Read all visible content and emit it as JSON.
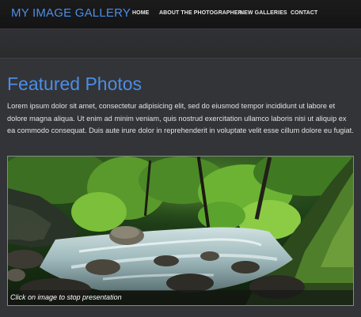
{
  "header": {
    "site_title": "MY IMAGE GALLERY",
    "nav": [
      {
        "label": "HOME"
      },
      {
        "label": "ABOUT THE PHOTOGRAPHER"
      },
      {
        "label": "NEW GALLERIES"
      },
      {
        "label": "CONTACT"
      }
    ]
  },
  "main": {
    "title": "Featured Photos",
    "intro": "Lorem ipsum dolor sit amet, consectetur adipisicing elit, sed do eiusmod tempor incididunt ut labore et dolore magna aliqua. Ut enim ad minim veniam, quis nostrud exercitation ullamco laboris nisi ut aliquip ex ea commodo consequat. Duis aute irure dolor in reprehenderit in voluptate velit esse cillum dolore eu fugiat.",
    "slideshow": {
      "caption": "Click on image to stop presentation",
      "image": "forest-stream-photo"
    }
  },
  "colors": {
    "accent": "#4a8ee8",
    "header_bg": "#1b1b1c",
    "content_bg": "#333437",
    "text": "#e2e2e2"
  }
}
